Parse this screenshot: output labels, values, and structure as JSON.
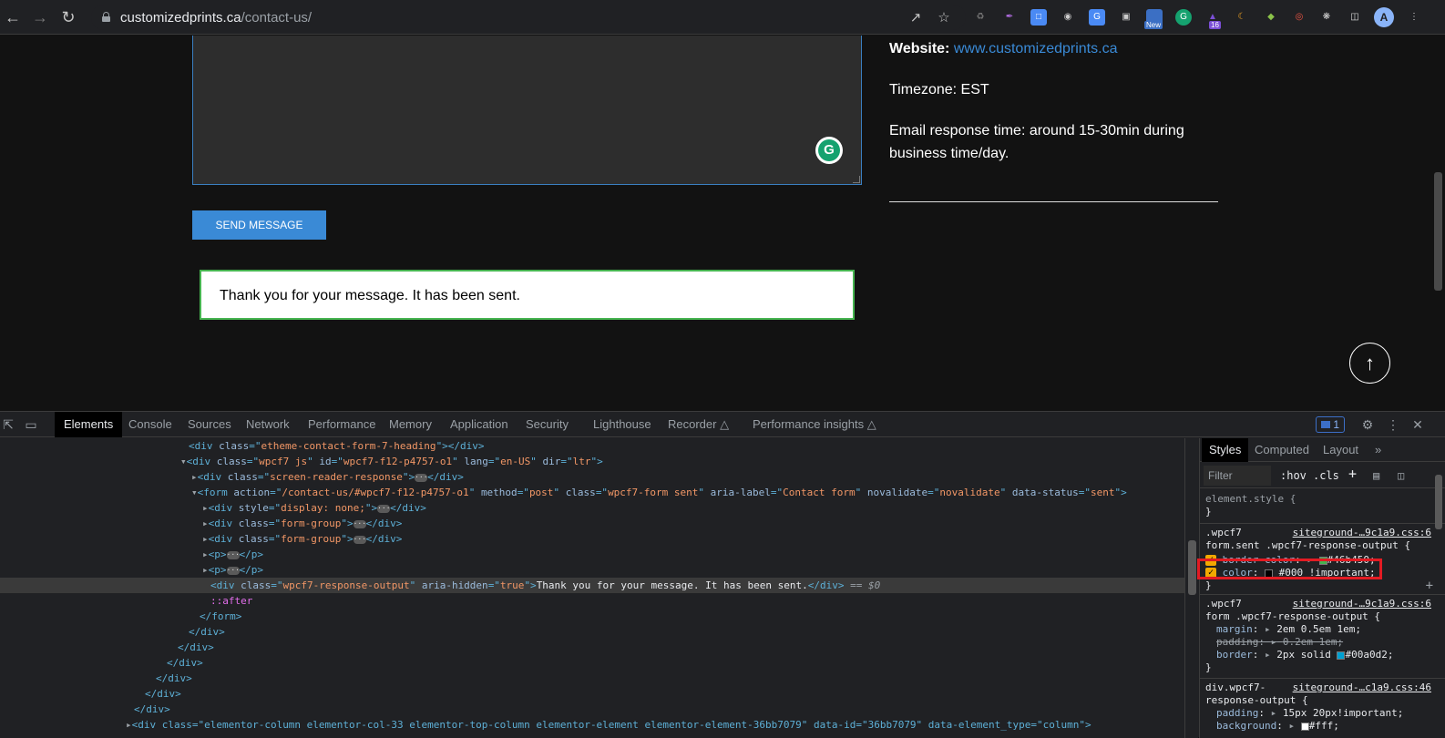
{
  "browser": {
    "url_host": "customizedprints.ca",
    "url_path": "/contact-us/",
    "ext_badge_new": "New",
    "ext_badge_count": "16",
    "avatar_letter": "A"
  },
  "page": {
    "send_button": "SEND MESSAGE",
    "response_message": "Thank you for your message. It has been sent.",
    "website_label": "Website:",
    "website_link": "www.customizedprints.ca",
    "timezone": "Timezone: EST",
    "email_response": "Email response time: around 15-30min during business time/day.",
    "grammarly_letter": "G"
  },
  "devtools": {
    "tabs": [
      "Elements",
      "Console",
      "Sources",
      "Network",
      "Performance",
      "Memory",
      "Application",
      "Security",
      "Lighthouse",
      "Recorder",
      "Performance insights"
    ],
    "issues_count": "1",
    "styles_tabs": [
      "Styles",
      "Computed",
      "Layout"
    ],
    "filter_placeholder": "Filter",
    "hov": ":hov",
    "cls": ".cls",
    "element_style": "element.style {",
    "closing_brace": "}",
    "rules": [
      {
        "selector_1": ".wpcf7",
        "selector_2": "form.sent .wpcf7-response-output {",
        "source": "siteground-…9c1a9.css:6",
        "props": [
          {
            "name": "border-color",
            "value": "#46b450;",
            "swatch": "#46b450"
          },
          {
            "name": "color",
            "value": "#000 !important;",
            "swatch": "#000000"
          }
        ]
      },
      {
        "selector_1": ".wpcf7",
        "selector_2": "form .wpcf7-response-output {",
        "source": "siteground-…9c1a9.css:6",
        "props": [
          {
            "name": "margin",
            "value": "2em 0.5em 1em;"
          },
          {
            "name": "padding",
            "value": "0.2em 1em;"
          },
          {
            "name": "border",
            "value": "2px solid",
            "value2": "#00a0d2;",
            "swatch": "#00a0d2"
          }
        ]
      },
      {
        "selector_1": "div.wpcf7-",
        "selector_2": "response-output {",
        "source": "siteground-…c1a9.css:46",
        "props": [
          {
            "name": "padding",
            "value": "15px 20px!important;"
          },
          {
            "name": "background",
            "value": "#fff;",
            "swatch": "#ffffff"
          }
        ]
      }
    ],
    "dom": {
      "l1_class": "etheme-contact-form-7-heading",
      "l2_class": "wpcf7 js",
      "l2_id": "wpcf7-f12-p4757-o1",
      "l2_lang": "en-US",
      "l2_dir": "ltr",
      "l3_class": "screen-reader-response",
      "form_action": "/contact-us/#wpcf7-f12-p4757-o1",
      "form_method": "post",
      "form_class": "wpcf7-form sent",
      "form_aria": "Contact form",
      "form_novalidate": "novalidate",
      "form_status": "sent",
      "div_style": "display: none;",
      "fg_class": "form-group",
      "resp_class": "wpcf7-response-output",
      "resp_aria": "true",
      "resp_text": "Thank you for your message. It has been sent.",
      "eq0": "== $0",
      "after": "::after",
      "last_line": "<div class=\"elementor-column elementor-col-33 elementor-top-column elementor-element elementor-element-36bb7079\" data-id=\"36bb7079\" data-element_type=\"column\">"
    }
  }
}
